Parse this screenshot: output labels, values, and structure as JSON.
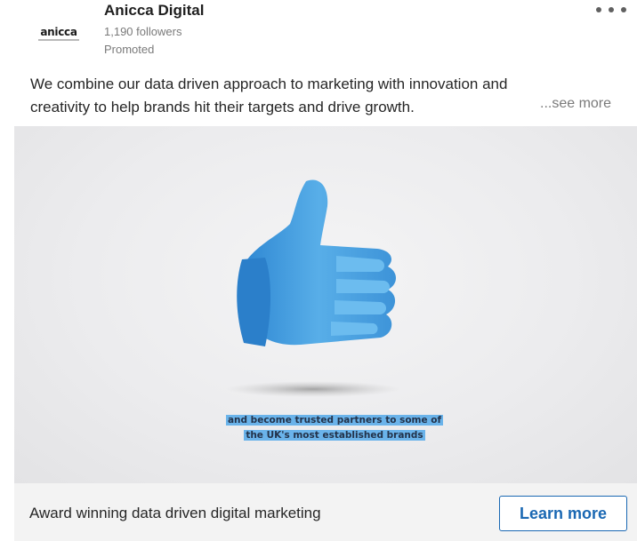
{
  "post": {
    "company": "Anicca Digital",
    "logo_text": "anicca",
    "followers": "1,190 followers",
    "label": "Promoted",
    "text_lines": [
      "We combine our data driven approach to marketing with innovation and",
      "creativity to help brands hit their targets and drive growth."
    ],
    "see_more": "...see more"
  },
  "media": {
    "caption_lines": [
      "and become trusted partners to some of",
      "the UK's most established brands"
    ],
    "icon": "thumbs-up-icon",
    "accent_color": "#5aaee6",
    "caption_bg": "#6ab3ea"
  },
  "footer": {
    "headline": "Award winning data driven digital marketing",
    "cta": "Learn more",
    "cta_color": "#1a68b3"
  }
}
